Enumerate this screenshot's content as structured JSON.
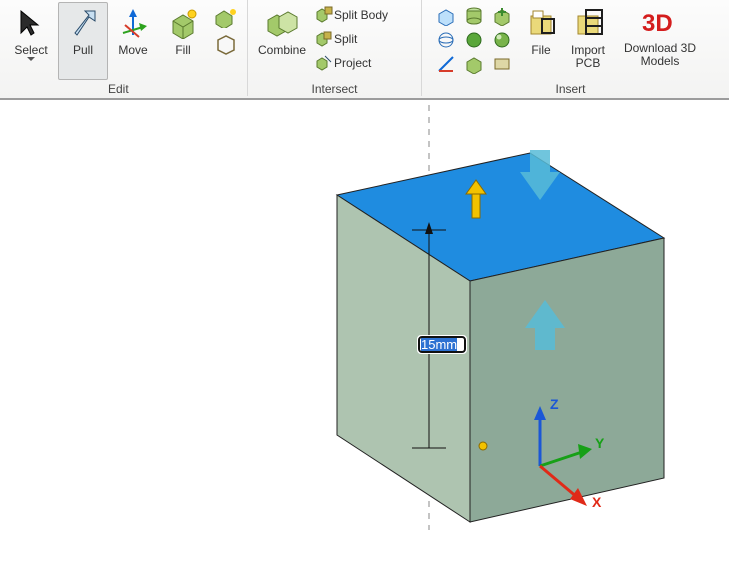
{
  "ribbon": {
    "edit": {
      "group_label": "Edit",
      "select": {
        "label": "Select"
      },
      "pull": {
        "label": "Pull"
      },
      "move": {
        "label": "Move"
      },
      "fill": {
        "label": "Fill"
      }
    },
    "intersect": {
      "group_label": "Intersect",
      "combine": {
        "label": "Combine"
      },
      "split_body": {
        "label": "Split Body"
      },
      "split": {
        "label": "Split"
      },
      "project": {
        "label": "Project"
      }
    },
    "insert": {
      "group_label": "Insert",
      "file": {
        "label": "File"
      },
      "import_pcb": {
        "label": "Import\nPCB"
      },
      "download_3d": {
        "label": "Download 3D\nModels"
      }
    }
  },
  "viewport": {
    "dimension_value": "15mm",
    "axes": {
      "x": "X",
      "y": "Y",
      "z": "Z"
    }
  }
}
